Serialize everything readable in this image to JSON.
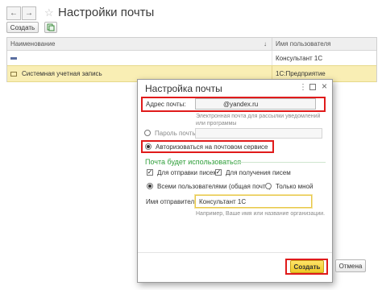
{
  "window": {
    "title": "Настройки почты"
  },
  "toolbar": {
    "create_label": "Создать"
  },
  "table": {
    "columns": [
      "Наименование",
      "Имя пользователя"
    ],
    "rows": [
      {
        "name": "",
        "user": "Консультант 1С"
      },
      {
        "name": "Системная учетная запись",
        "user": "1С:Предприятие"
      }
    ]
  },
  "dialog": {
    "title": "Настройка почты",
    "email_label": "Адрес почты:",
    "email_value": "@yandex.ru",
    "email_hint": "Электронная почта для рассылки уведомлений или программы",
    "password_label": "Пароль почты:",
    "auth_label": "Авторизоваться на почтовом сервисе",
    "usage_title": "Почта будет использоваться",
    "send_label": "Для отправки писем",
    "receive_label": "Для получения писем",
    "all_users_label": "Всеми пользователями (общая почта)",
    "only_me_label": "Только мной",
    "sender_label": "Имя отправителя:",
    "sender_value": "Консультант 1С",
    "sender_hint": "Например, Ваше имя или название организации.",
    "create_label": "Создать",
    "cancel_label": "Отмена"
  },
  "colors": {
    "selected_row": "#f9eeb4",
    "accent_green": "#2f9e3a",
    "highlight_red": "#e01b1b",
    "primary_button": "#f3d23a"
  }
}
